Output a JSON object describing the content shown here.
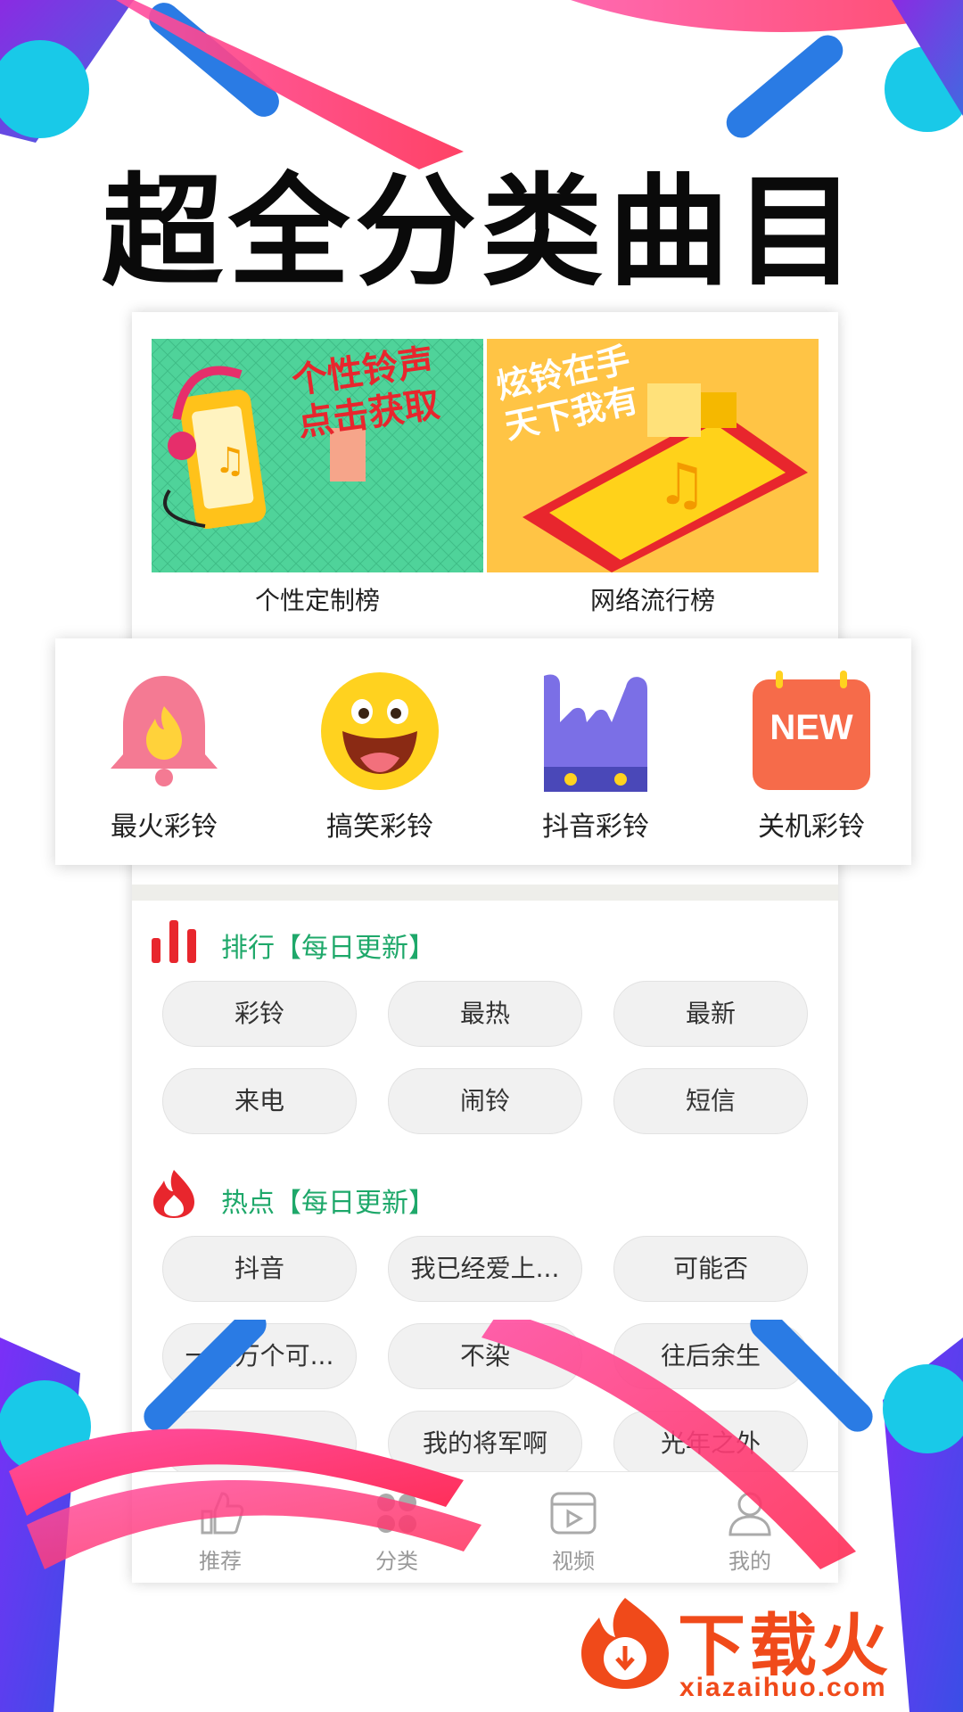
{
  "headline": "超全分类曲目",
  "banners": [
    {
      "image_text": "个性铃声 点击获取",
      "label": "个性定制榜"
    },
    {
      "image_text": "炫铃在手 天下我有",
      "label": "网络流行榜"
    }
  ],
  "categories": [
    {
      "icon": "flame-bell-icon",
      "label": "最火彩铃"
    },
    {
      "icon": "laughing-face-icon",
      "label": "搞笑彩铃"
    },
    {
      "icon": "rock-hand-icon",
      "label": "抖音彩铃"
    },
    {
      "icon": "new-badge-icon",
      "label": "关机彩铃",
      "badge_text": "NEW"
    }
  ],
  "ranking": {
    "icon": "bar-chart-icon",
    "title": "排行【每日更新】",
    "tags": [
      "彩铃",
      "最热",
      "最新",
      "来电",
      "闹铃",
      "短信"
    ]
  },
  "hot": {
    "icon": "flame-icon",
    "title": "热点【每日更新】",
    "tags": [
      "抖音",
      "我已经爱上...",
      "可能否",
      "一百万个可...",
      "不染",
      "往后余生",
      "",
      "我的将军啊",
      "光年之外"
    ]
  },
  "tabbar": [
    {
      "icon": "thumb-up-icon",
      "label": "推荐"
    },
    {
      "icon": "category-icon",
      "label": "分类"
    },
    {
      "icon": "video-play-icon",
      "label": "视频"
    },
    {
      "icon": "user-icon",
      "label": "我的"
    }
  ],
  "watermark": {
    "brand": "下载火",
    "domain": "xiazaihuo.com"
  },
  "colors": {
    "accent_green": "#1ea86a",
    "rank_red": "#e8262d",
    "tag_bg": "#f1f1f1",
    "watermark_orange": "#f04a1a"
  }
}
